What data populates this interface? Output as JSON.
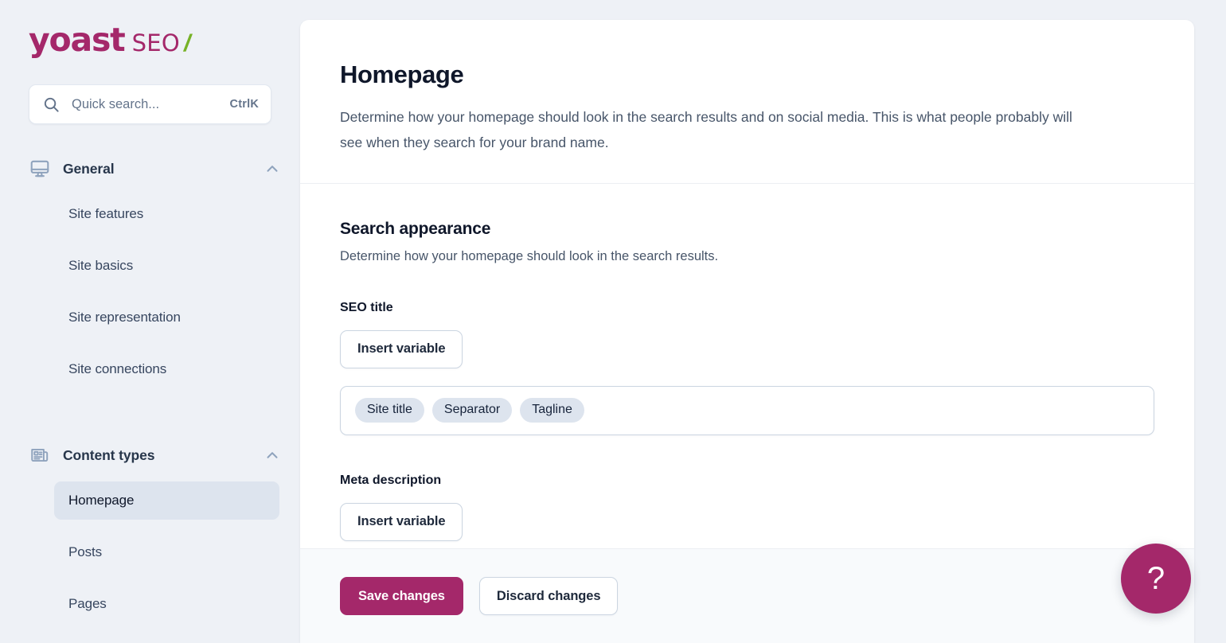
{
  "brand": {
    "name": "yoast",
    "product": "SEO",
    "slash": "/",
    "color": "#a4286a",
    "accent_green": "#77b227"
  },
  "search": {
    "placeholder": "Quick search...",
    "value": "",
    "shortcut": "CtrlK",
    "icon": "search-icon"
  },
  "sidebar": {
    "groups": [
      {
        "label": "General",
        "icon": "monitor-icon",
        "chevron": "chevron-up-icon",
        "expanded": true,
        "items": [
          {
            "label": "Site features",
            "active": false
          },
          {
            "label": "Site basics",
            "active": false
          },
          {
            "label": "Site representation",
            "active": false
          },
          {
            "label": "Site connections",
            "active": false
          }
        ]
      },
      {
        "label": "Content types",
        "icon": "newspaper-icon",
        "chevron": "chevron-up-icon",
        "expanded": true,
        "items": [
          {
            "label": "Homepage",
            "active": true
          },
          {
            "label": "Posts",
            "active": false
          },
          {
            "label": "Pages",
            "active": false
          }
        ]
      }
    ]
  },
  "main": {
    "title": "Homepage",
    "description": "Determine how your homepage should look in the search results and on social media. This is what people probably will see when they search for your brand name.",
    "section": {
      "title": "Search appearance",
      "description": "Determine how your homepage should look in the search results."
    },
    "seo_title": {
      "label": "SEO title",
      "insert_variable_label": "Insert variable",
      "variables": [
        {
          "label": "Site title"
        },
        {
          "label": "Separator"
        },
        {
          "label": "Tagline"
        }
      ]
    },
    "meta_description": {
      "label": "Meta description",
      "insert_variable_label": "Insert variable"
    }
  },
  "footer": {
    "save_label": "Save changes",
    "discard_label": "Discard changes"
  },
  "help": {
    "label": "?",
    "icon": "question-mark-icon"
  }
}
